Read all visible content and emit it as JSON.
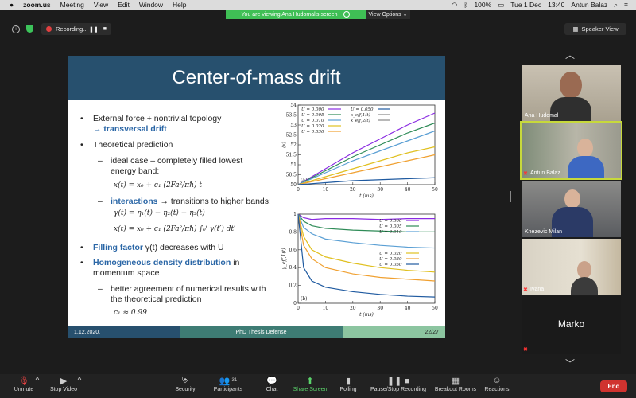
{
  "menubar": {
    "app": "zoom.us",
    "items": [
      "Meeting",
      "View",
      "Edit",
      "Window",
      "Help"
    ],
    "status": {
      "battery": "100%",
      "date": "Tue 1 Dec",
      "time": "13:40",
      "user": "Antun Balaz"
    }
  },
  "banner": {
    "text": "You are viewing Ana Hudomal's screen",
    "view_options": "View Options"
  },
  "recording": {
    "label": "Recording..."
  },
  "speaker_view": {
    "label": "Speaker View"
  },
  "slide": {
    "title": "Center-of-mass drift",
    "bullets": [
      {
        "text": "External force + nontrivial topology"
      },
      {
        "text": "→ transversal drift"
      },
      {
        "text": "Theoretical prediction"
      },
      {
        "text": "ideal case – completely filled lowest energy band:"
      },
      {
        "text": "x(t) = x₀ + c₁ (2Fa²/πħ) t"
      },
      {
        "text": "interactions",
        "rest": "→ transitions to higher bands:"
      },
      {
        "text": "γ(t) = η₁(t) − η₂(t) + η₃(t)"
      },
      {
        "text": "x(t) = x₀ + c₁ (2Fa²/πħ) ∫₀ᵗ γ(t′) dt′"
      },
      {
        "text": "Filling factor",
        "rest": "γ(t) decreases with U"
      },
      {
        "text": "Homogeneous density distribution",
        "rest": "in momentum space"
      },
      {
        "text": "better agreement of numerical results with the theoretical prediction"
      },
      {
        "text": "c₁ ≈ 0.99"
      }
    ],
    "footer": {
      "date": "1.12.2020.",
      "event": "PhD Thesis Defense",
      "page": "22/27"
    }
  },
  "chart_data": [
    {
      "type": "line",
      "panel_label": "(a)",
      "xlabel": "t (ms)",
      "ylabel": "⟨x⟩",
      "xlim": [
        0,
        50
      ],
      "ylim": [
        50,
        54
      ],
      "xticks": [
        0,
        10,
        20,
        30,
        40,
        50
      ],
      "yticks": [
        50,
        50.5,
        51,
        51.5,
        52,
        52.5,
        53,
        53.5,
        54
      ],
      "legend": [
        {
          "name": "U = 0.000",
          "color": "#8a2be2"
        },
        {
          "name": "U = 0.005",
          "color": "#2e8b57"
        },
        {
          "name": "U = 0.010",
          "color": "#5a9fd4"
        },
        {
          "name": "U = 0.020",
          "color": "#e0c020"
        },
        {
          "name": "U = 0.030",
          "color": "#f0a030"
        },
        {
          "name": "U = 0.050",
          "color": "#1f5aa0"
        },
        {
          "name": "x_eff,1(t)",
          "color": "#888"
        },
        {
          "name": "x_eff,2(t)",
          "color": "#888"
        }
      ],
      "series": [
        {
          "name": "U = 0.000",
          "color": "#8a2be2",
          "x": [
            0,
            10,
            20,
            30,
            40,
            50
          ],
          "y": [
            50.0,
            50.8,
            51.6,
            52.3,
            53.0,
            53.6
          ]
        },
        {
          "name": "U = 0.005",
          "color": "#2e8b57",
          "x": [
            0,
            10,
            20,
            30,
            40,
            50
          ],
          "y": [
            50.0,
            50.7,
            51.4,
            52.0,
            52.6,
            53.1
          ]
        },
        {
          "name": "U = 0.010",
          "color": "#5a9fd4",
          "x": [
            0,
            10,
            20,
            30,
            40,
            50
          ],
          "y": [
            50.0,
            50.6,
            51.2,
            51.7,
            52.2,
            52.7
          ]
        },
        {
          "name": "U = 0.020",
          "color": "#e0c020",
          "x": [
            0,
            10,
            20,
            30,
            40,
            50
          ],
          "y": [
            50.0,
            50.4,
            50.8,
            51.2,
            51.6,
            51.9
          ]
        },
        {
          "name": "U = 0.030",
          "color": "#f0a030",
          "x": [
            0,
            10,
            20,
            30,
            40,
            50
          ],
          "y": [
            50.0,
            50.3,
            50.6,
            50.9,
            51.2,
            51.5
          ]
        },
        {
          "name": "U = 0.050",
          "color": "#1f5aa0",
          "x": [
            0,
            10,
            20,
            30,
            40,
            50
          ],
          "y": [
            50.0,
            50.1,
            50.2,
            50.25,
            50.3,
            50.35
          ]
        }
      ]
    },
    {
      "type": "line",
      "panel_label": "(b)",
      "xlabel": "t (ms)",
      "ylabel": "γ_eff,1(t)",
      "xlim": [
        0,
        50
      ],
      "ylim": [
        0,
        1
      ],
      "xticks": [
        0,
        10,
        20,
        30,
        40,
        50
      ],
      "yticks": [
        0,
        0.2,
        0.4,
        0.6,
        0.8,
        1
      ],
      "legend": [
        {
          "name": "U = 0.000",
          "color": "#8a2be2"
        },
        {
          "name": "U = 0.005",
          "color": "#2e8b57"
        },
        {
          "name": "U = 0.010",
          "color": "#5a9fd4"
        },
        {
          "name": "U = 0.020",
          "color": "#e0c020"
        },
        {
          "name": "U = 0.030",
          "color": "#f0a030"
        },
        {
          "name": "U = 0.050",
          "color": "#1f5aa0"
        }
      ],
      "series": [
        {
          "name": "U = 0.000",
          "color": "#8a2be2",
          "x": [
            0,
            2,
            5,
            10,
            20,
            30,
            40,
            50
          ],
          "y": [
            1.0,
            0.96,
            0.94,
            0.95,
            0.95,
            0.94,
            0.95,
            0.95
          ]
        },
        {
          "name": "U = 0.005",
          "color": "#2e8b57",
          "x": [
            0,
            2,
            5,
            10,
            20,
            30,
            40,
            50
          ],
          "y": [
            1.0,
            0.92,
            0.87,
            0.84,
            0.82,
            0.81,
            0.8,
            0.8
          ]
        },
        {
          "name": "U = 0.010",
          "color": "#5a9fd4",
          "x": [
            0,
            2,
            5,
            10,
            20,
            30,
            40,
            50
          ],
          "y": [
            1.0,
            0.85,
            0.78,
            0.72,
            0.68,
            0.65,
            0.63,
            0.62
          ]
        },
        {
          "name": "U = 0.020",
          "color": "#e0c020",
          "x": [
            0,
            2,
            5,
            10,
            20,
            30,
            40,
            50
          ],
          "y": [
            1.0,
            0.75,
            0.6,
            0.52,
            0.45,
            0.4,
            0.37,
            0.35
          ]
        },
        {
          "name": "U = 0.030",
          "color": "#f0a030",
          "x": [
            0,
            2,
            5,
            10,
            20,
            30,
            40,
            50
          ],
          "y": [
            1.0,
            0.65,
            0.5,
            0.4,
            0.33,
            0.29,
            0.27,
            0.25
          ]
        },
        {
          "name": "U = 0.050",
          "color": "#1f5aa0",
          "x": [
            0,
            2,
            5,
            10,
            20,
            30,
            40,
            50
          ],
          "y": [
            1.0,
            0.4,
            0.25,
            0.18,
            0.13,
            0.1,
            0.08,
            0.07
          ]
        }
      ]
    }
  ],
  "participants": [
    {
      "name": "Ana Hudomal"
    },
    {
      "name": "Antun Balaz",
      "active": true,
      "muted": true
    },
    {
      "name": "Knezevic Milan"
    },
    {
      "name": "Ivana",
      "muted": true
    },
    {
      "name": "Marko",
      "muted": true
    }
  ],
  "toolbar": {
    "unmute": "Unmute",
    "stop_video": "Stop Video",
    "security": "Security",
    "participants": "Participants",
    "participants_count": "31",
    "chat": "Chat",
    "share_screen": "Share Screen",
    "polling": "Polling",
    "pause_recording": "Pause/Stop Recording",
    "breakout_rooms": "Breakout Rooms",
    "reactions": "Reactions",
    "end": "End"
  }
}
